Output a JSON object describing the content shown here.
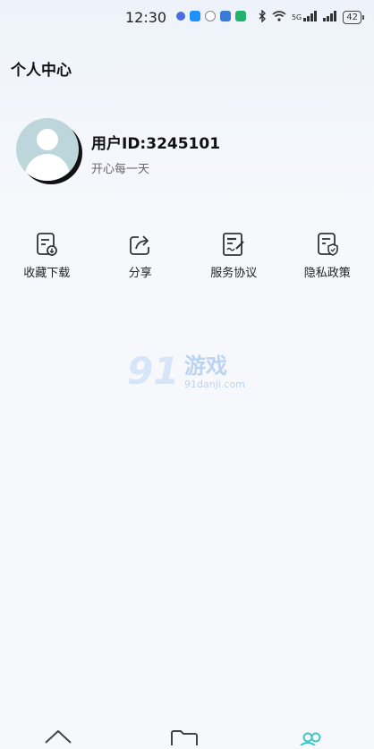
{
  "status_bar": {
    "time": "12:30",
    "signal_text": "5G",
    "battery": "42"
  },
  "header": {
    "title": "个人中心"
  },
  "profile": {
    "user_id": "用户ID:3245101",
    "motto": "开心每一天"
  },
  "menu": [
    {
      "label": "收藏下载",
      "icon": "download-doc-icon"
    },
    {
      "label": "分享",
      "icon": "share-icon"
    },
    {
      "label": "服务协议",
      "icon": "agreement-doc-icon"
    },
    {
      "label": "隐私政策",
      "icon": "privacy-shield-doc-icon"
    }
  ],
  "watermark": {
    "brand": "游戏",
    "domain": "91danji.com"
  },
  "bottom_nav": [
    {
      "icon": "home-icon"
    },
    {
      "icon": "folder-icon"
    },
    {
      "icon": "users-icon"
    }
  ],
  "colors": {
    "accent": "#3cc8c8",
    "avatar_bg": "#bcd6dc"
  }
}
